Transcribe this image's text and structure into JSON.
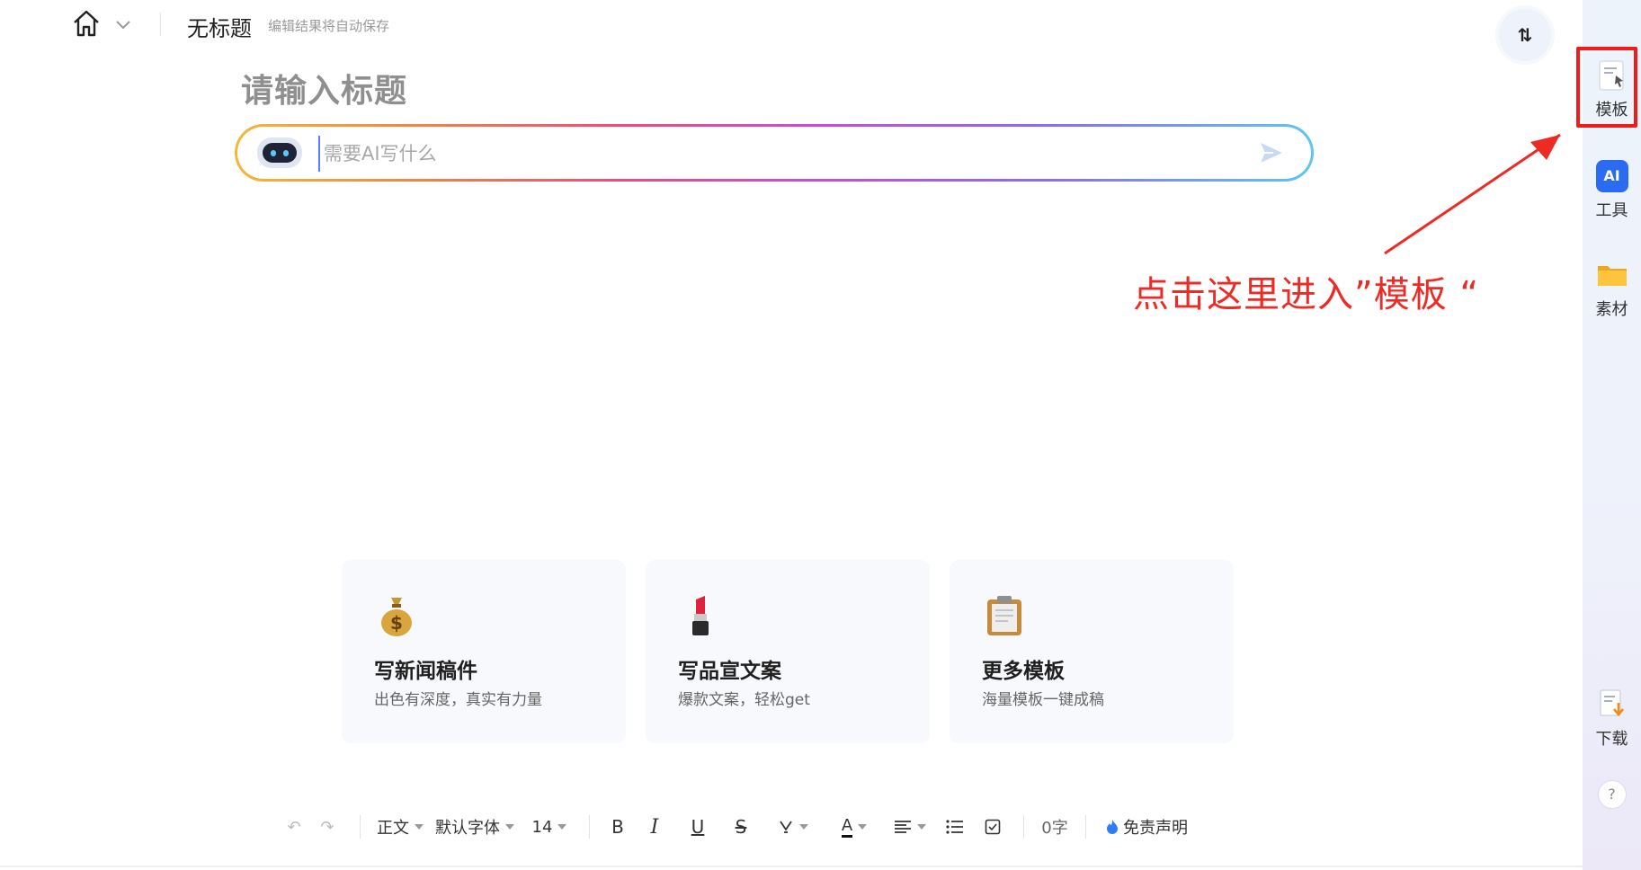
{
  "header": {
    "doc_title": "无标题",
    "save_hint": "编辑结果将自动保存",
    "switch_label": "⇅"
  },
  "editor": {
    "title_placeholder": "请输入标题"
  },
  "ai_input": {
    "placeholder": "需要AI写什么"
  },
  "cards": [
    {
      "icon": "money-bag-icon",
      "title": "写新闻稿件",
      "desc": "出色有深度，真实有力量"
    },
    {
      "icon": "lipstick-icon",
      "title": "写品宣文案",
      "desc": "爆款文案，轻松get"
    },
    {
      "icon": "clipboard-icon",
      "title": "更多模板",
      "desc": "海量模板一键成稿"
    }
  ],
  "toolbar": {
    "paragraph_style": "正文",
    "font_family": "默认字体",
    "font_size": "14",
    "bold": "B",
    "italic": "I",
    "underline": "U",
    "strike": "S",
    "font_color": "A",
    "word_count": "0字",
    "disclaimer": "免责声明"
  },
  "sidebar": {
    "items": [
      {
        "label": "模板"
      },
      {
        "label": "工具",
        "badge": "AI"
      },
      {
        "label": "素材"
      },
      {
        "label": "下载"
      }
    ],
    "help": "?"
  },
  "annotation": {
    "text": "点击这里进入”模板 “",
    "color": "#ee2a24"
  }
}
